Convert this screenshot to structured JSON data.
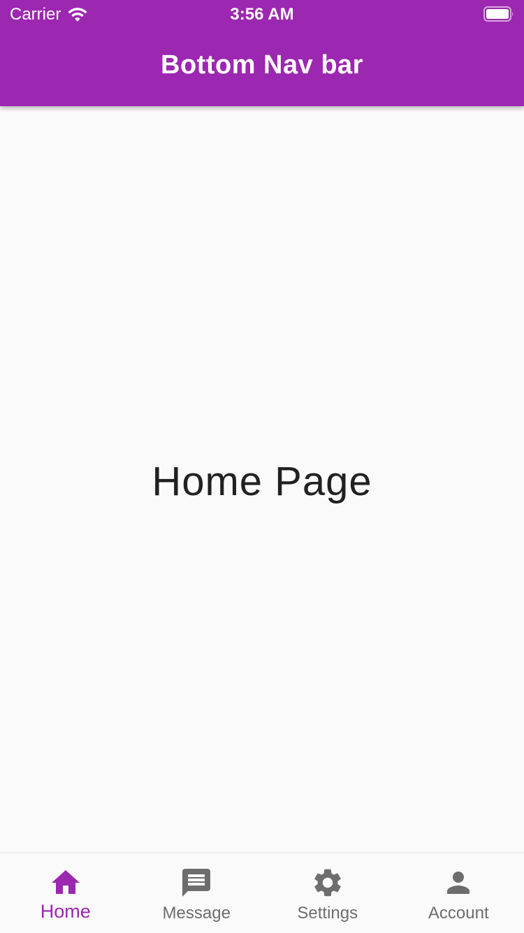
{
  "status_bar": {
    "carrier": "Carrier",
    "time": "3:56 AM",
    "wifi_icon": "wifi-icon",
    "battery_icon": "battery-icon"
  },
  "app_bar": {
    "title": "Bottom Nav bar",
    "background_color": "#9c27b0"
  },
  "main": {
    "page_label": "Home Page"
  },
  "bottom_nav": {
    "active_color": "#9c27b0",
    "inactive_color": "#6d6d6d",
    "items": [
      {
        "label": "Home",
        "icon": "home-icon",
        "active": true
      },
      {
        "label": "Message",
        "icon": "message-icon",
        "active": false
      },
      {
        "label": "Settings",
        "icon": "gear-icon",
        "active": false
      },
      {
        "label": "Account",
        "icon": "person-icon",
        "active": false
      }
    ]
  }
}
